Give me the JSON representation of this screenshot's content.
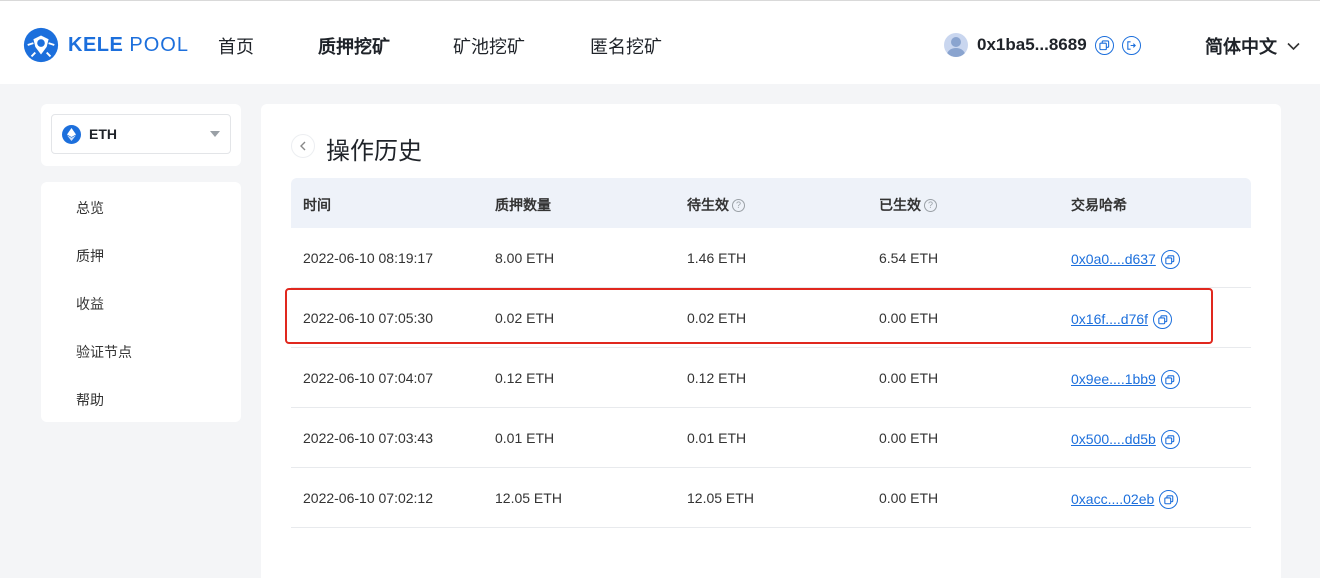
{
  "header": {
    "logo": {
      "brand": "KELE",
      "pool": "POOL"
    },
    "nav": [
      {
        "label": "首页"
      },
      {
        "label": "质押挖矿"
      },
      {
        "label": "矿池挖矿"
      },
      {
        "label": "匿名挖矿"
      }
    ],
    "active_nav": "质押挖矿",
    "wallet": {
      "address": "0x1ba5...8689",
      "icons": [
        "copy-icon",
        "logout-icon"
      ]
    },
    "language": "简体中文"
  },
  "sidebar": {
    "asset_select": {
      "value": "ETH",
      "icon": "ethereum-icon"
    },
    "menu": [
      {
        "label": "总览"
      },
      {
        "label": "质押"
      },
      {
        "label": "收益"
      },
      {
        "label": "验证节点"
      },
      {
        "label": "帮助"
      }
    ]
  },
  "main": {
    "title": "操作历史",
    "table": {
      "columns": [
        "时间",
        "质押数量",
        "待生效",
        "已生效",
        "交易哈希"
      ],
      "rows": [
        {
          "time": "2022-06-10 08:19:17",
          "amount": "8.00 ETH",
          "pending": "1.46 ETH",
          "active": "6.54 ETH",
          "hash": "0x0a0....d637"
        },
        {
          "time": "2022-06-10 07:05:30",
          "amount": "0.02 ETH",
          "pending": "0.02 ETH",
          "active": "0.00 ETH",
          "hash": "0x16f....d76f"
        },
        {
          "time": "2022-06-10 07:04:07",
          "amount": "0.12 ETH",
          "pending": "0.12 ETH",
          "active": "0.00 ETH",
          "hash": "0x9ee....1bb9"
        },
        {
          "time": "2022-06-10 07:03:43",
          "amount": "0.01 ETH",
          "pending": "0.01 ETH",
          "active": "0.00 ETH",
          "hash": "0x500....dd5b"
        },
        {
          "time": "2022-06-10 07:02:12",
          "amount": "12.05 ETH",
          "pending": "12.05 ETH",
          "active": "0.00 ETH",
          "hash": "0xacc....02eb"
        }
      ],
      "highlighted_row": 1
    }
  },
  "colors": {
    "accent": "#1c6fdc",
    "highlight": "#e0281e",
    "table_header": "#eef2f9",
    "background": "#f4f5f7"
  }
}
